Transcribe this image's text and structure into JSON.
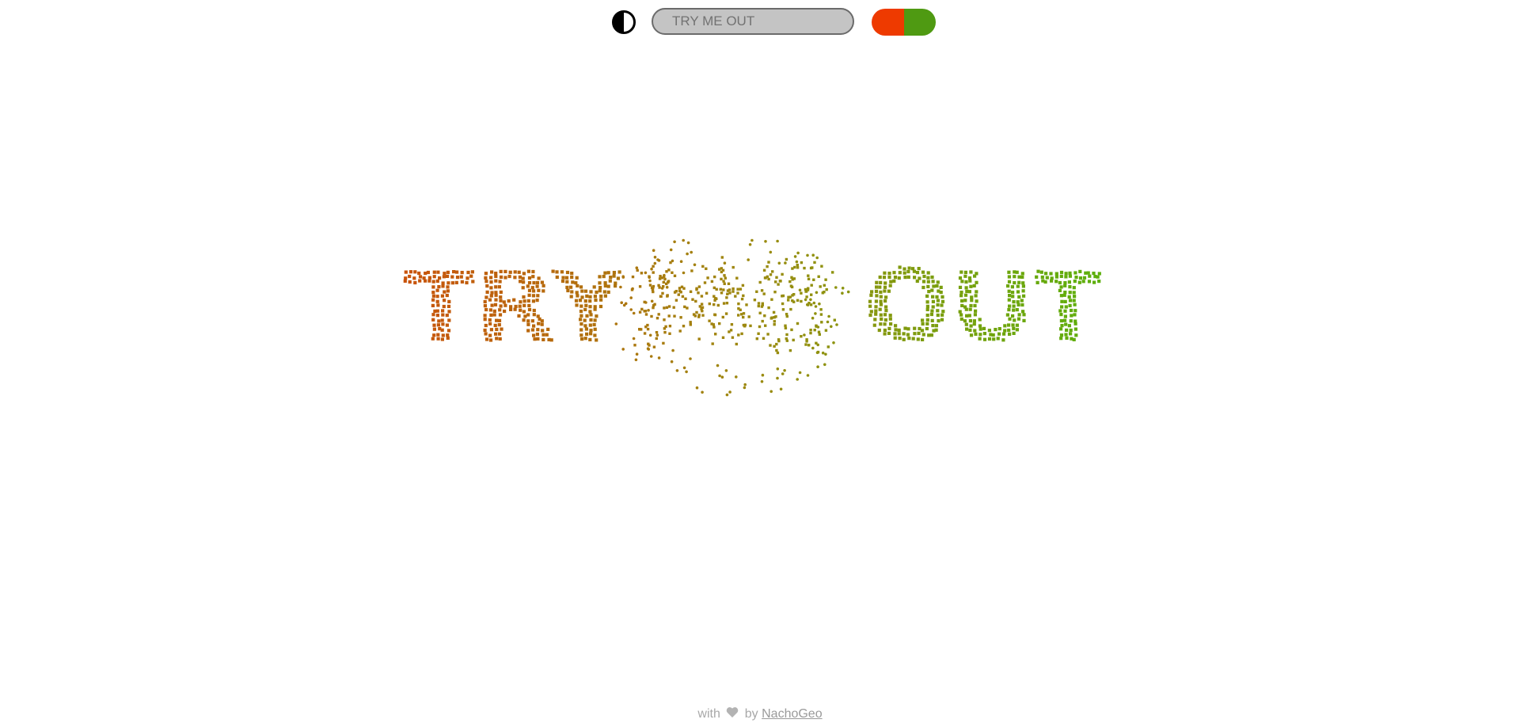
{
  "toolbar": {
    "contrast_icon": "half-circle-contrast-icon",
    "input_placeholder": "TRY ME OUT",
    "toggle_colors": [
      "#ee3a00",
      "#4f9a12"
    ]
  },
  "canvas": {
    "words": [
      "TRY",
      "ME",
      "OUT"
    ],
    "gradient_start": "#c9530a",
    "gradient_mid": "#9c8a10",
    "gradient_end": "#5cb00c",
    "particle_color_scattered": "#9e8a14"
  },
  "footer": {
    "with": "with",
    "heart_icon": "heart-icon",
    "by": "by",
    "author": "NachoGeo"
  }
}
